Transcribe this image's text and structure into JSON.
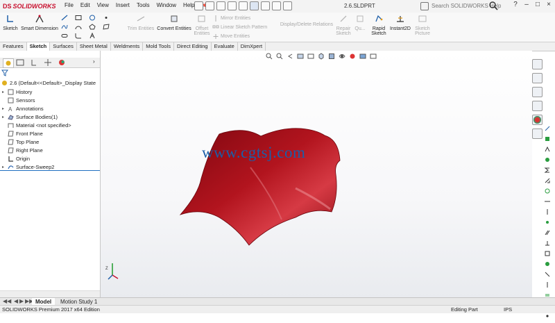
{
  "app": {
    "logo_prefix": "DS",
    "logo_text": "SOLIDWORKS",
    "doc_title": "2.6.SLDPRT",
    "search_placeholder": "Search SOLIDWORKS Help"
  },
  "menu": [
    "File",
    "Edit",
    "View",
    "Insert",
    "Tools",
    "Window",
    "Help"
  ],
  "ribbon": {
    "sketch": "Sketch",
    "smart_dimension": "Smart Dimension",
    "trim_entities_1": "Trim Entities",
    "convert_entities": "Convert Entities",
    "offset_entities_1": "Offset",
    "offset_entities_2": "Entities",
    "mirror_entities": "Mirror Entities",
    "linear_sketch_pattern": "Linear Sketch Pattern",
    "move_entities": "Move Entities",
    "display_delete_relations": "Display/Delete Relations",
    "repair_sketch_1": "Repair",
    "repair_sketch_2": "Sketch",
    "quick_snaps": "Qu...",
    "rapid_sketch_1": "Rapid",
    "rapid_sketch_2": "Sketch",
    "instant2d": "Instant2D",
    "sketch_picture_1": "Sketch",
    "sketch_picture_2": "Picture"
  },
  "tabs": [
    "Features",
    "Sketch",
    "Surfaces",
    "Sheet Metal",
    "Weldments",
    "Mold Tools",
    "Direct Editing",
    "Evaluate",
    "DimXpert"
  ],
  "active_tab": "Sketch",
  "tree": {
    "root": "2.6  (Default<<Default>_Display State",
    "items": [
      "History",
      "Sensors",
      "Annotations",
      "Surface Bodies(1)",
      "Material <not specified>",
      "Front Plane",
      "Top Plane",
      "Right Plane",
      "Origin",
      "Surface-Sweep2"
    ]
  },
  "model_tabs": [
    "Model",
    "Motion Study 1"
  ],
  "status": {
    "edition": "SOLIDWORKS Premium 2017 x64 Edition",
    "mode": "Editing Part",
    "units": "IPS"
  },
  "viewport": {
    "watermark": "www.cgtsj.com",
    "part_color": "#a3111c"
  },
  "colors": {
    "brand": "#c8102e",
    "tree_accent": "#1f6fc1"
  },
  "icons": {
    "search": "search-icon",
    "help": "help-icon",
    "minimize": "minimize-icon",
    "maximize": "maximize-icon",
    "close": "close-icon"
  }
}
